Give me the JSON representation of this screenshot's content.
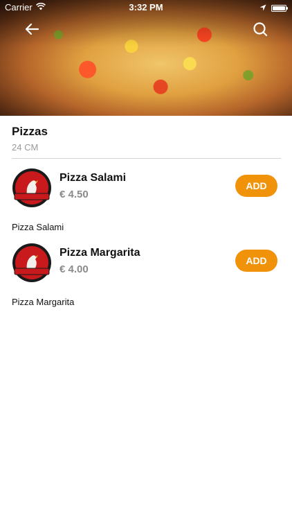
{
  "status_bar": {
    "carrier": "Carrier",
    "time": "3:32 PM"
  },
  "header": {
    "back_icon": "arrow-left-icon",
    "search_icon": "search-icon"
  },
  "section": {
    "title": "Pizzas",
    "subtitle": "24 CM"
  },
  "items": [
    {
      "name": "Pizza Salami",
      "price": "€ 4.50",
      "add_label": "ADD",
      "description": "Pizza Salami"
    },
    {
      "name": "Pizza Margarita",
      "price": "€ 4.00",
      "add_label": "ADD",
      "description": "Pizza Margarita"
    }
  ],
  "colors": {
    "accent": "#f0930b",
    "price": "#8a8a8a",
    "subtitle": "#9a9a9a"
  }
}
